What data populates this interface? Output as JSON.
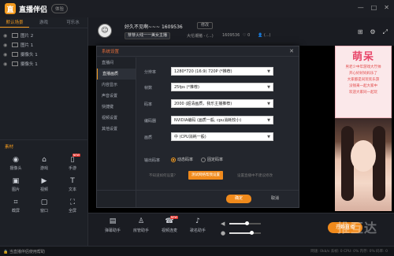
{
  "app": {
    "name": "直播伴侣",
    "version_badge": "体验"
  },
  "window_controls": [
    "—",
    "□",
    "✕"
  ],
  "scene_tabs": [
    {
      "label": "默认场景"
    },
    {
      "label": "游戏"
    },
    {
      "label": "可乐水"
    }
  ],
  "sources": [
    {
      "label": "图片 2",
      "extra": ""
    },
    {
      "label": "图片 1",
      "extra": ""
    },
    {
      "label": "摄像头 1",
      "extra": ""
    },
    {
      "label": "摄像头 1",
      "extra": ""
    }
  ],
  "materials": {
    "title": "素材",
    "items": [
      {
        "label": "摄像头",
        "icon": "camera-icon",
        "glyph": "◉",
        "new": false
      },
      {
        "label": "游戏",
        "icon": "gamepad-icon",
        "glyph": "⌂",
        "new": false
      },
      {
        "label": "手游",
        "icon": "mobile-icon",
        "glyph": "▯",
        "new": true
      },
      {
        "label": "图片",
        "icon": "image-icon",
        "glyph": "▣",
        "new": false
      },
      {
        "label": "视频",
        "icon": "video-icon",
        "glyph": "▶",
        "new": false
      },
      {
        "label": "文本",
        "icon": "text-icon",
        "glyph": "T",
        "new": false
      },
      {
        "label": "截屏",
        "icon": "crop-icon",
        "glyph": "⌗",
        "new": false
      },
      {
        "label": "窗口",
        "icon": "window-icon",
        "glyph": "▢",
        "new": false
      },
      {
        "label": "全屏",
        "icon": "fullscreen-icon",
        "glyph": "⛶",
        "new": false
      }
    ],
    "new_tag": "NEW"
  },
  "streamer": {
    "name": "好久不见啊~~~ 1609536",
    "edit_label": "修改",
    "tag": "芽芽火线一一美女主播",
    "category": "大伦潮猪 - (...)",
    "room_id": "1609536",
    "likes": "♡ 0",
    "fans": "👤 (...)"
  },
  "header_icons": [
    "share-icon",
    "settings-icon",
    "expand-icon"
  ],
  "modal": {
    "title": "系统设置",
    "close": "✕",
    "nav": [
      "直播间",
      "直播画质",
      "内容显示",
      "声音设置",
      "快捷键",
      "视频设置",
      "其他设置"
    ],
    "active_nav": 1,
    "fields": {
      "resolution_label": "分辨率",
      "resolution_value": "1280*720 (16:9) 720P (*推荐)",
      "fps_label": "帧数",
      "fps_value": "25fps (*推荐)",
      "bitrate_label": "码率",
      "bitrate_value": "2000 (超清画质，我乐主播推荐)",
      "encoder_label": "编码器",
      "encoder_value": "NVIDIA编码 (画质一般, cpu消耗较小)",
      "quality_label": "画质",
      "quality_value": "中 (CPU消耗一般)",
      "output_label": "输出码率",
      "output_dynamic": "动态码率",
      "output_fixed": "固定码率",
      "test_prompt": "不知道如何设置？",
      "test_button": "测试网络帮我设置",
      "test_note": "设置直播中不建议修改"
    },
    "ok": "确定",
    "cancel": "取消"
  },
  "ad": {
    "title": "萌呆",
    "lines": [
      "男老少中年游戏大厅帅",
      "开心好好妈妈乐了",
      "大家都是同玩欢乐游",
      "没钱来一起大家中",
      "欢迎大家同一起玩"
    ]
  },
  "toolbar": {
    "tools": [
      {
        "label": "弹幕助手",
        "icon": "danmaku-icon",
        "glyph": "▤",
        "new": false
      },
      {
        "label": "房管助手",
        "icon": "admin-icon",
        "glyph": "♙",
        "new": false
      },
      {
        "label": "视频连麦",
        "icon": "call-icon",
        "glyph": "☎",
        "new": true
      },
      {
        "label": "歌名助手",
        "icon": "music-icon",
        "glyph": "♪",
        "new": false
      }
    ],
    "speaker_volume": 0.55,
    "mic_volume": 0.72,
    "start_label": "开始直播"
  },
  "watermark": "推互达",
  "status": {
    "text": "🔒 当直播伴侣使用帮助",
    "stats": "网速: 0kb/s    丢帧: 0    CPU: 0%    内存: 0%    码率: 0"
  }
}
